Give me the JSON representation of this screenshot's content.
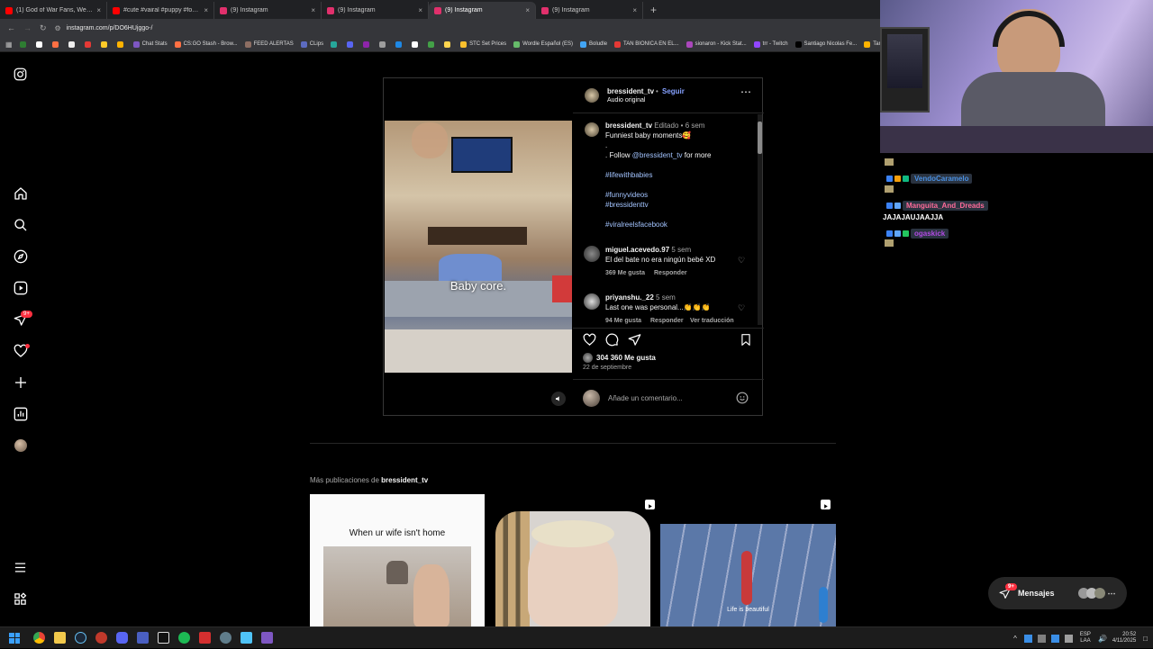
{
  "browser": {
    "tabs": [
      {
        "title": "(1) God of War Fans, We Got S...",
        "icon": "youtube-icon",
        "color": "#ff0000",
        "active": false
      },
      {
        "title": "#cute #vairal #puppy #foryou",
        "icon": "youtube-icon",
        "color": "#ff0000",
        "active": false
      },
      {
        "title": "(9) Instagram",
        "icon": "instagram-icon",
        "color": "#e1306c",
        "active": false
      },
      {
        "title": "(9) Instagram",
        "icon": "instagram-icon",
        "color": "#e1306c",
        "active": false
      },
      {
        "title": "(9) Instagram",
        "icon": "instagram-icon",
        "color": "#e1306c",
        "active": true
      },
      {
        "title": "(9) Instagram",
        "icon": "instagram-icon",
        "color": "#e1306c",
        "active": false
      }
    ],
    "new_tab": "+",
    "url": "instagram.com/p/DO6HUjggo-/",
    "bookmarks": [
      {
        "label": "",
        "color": "#2e7d32"
      },
      {
        "label": "",
        "color": "#ffffff"
      },
      {
        "label": "",
        "color": "#ff7043"
      },
      {
        "label": "",
        "color": "#eeeeee"
      },
      {
        "label": "",
        "color": "#e53935"
      },
      {
        "label": "",
        "color": "#ffca28"
      },
      {
        "label": "",
        "color": "#ffb300"
      },
      {
        "label": "Chat Stats",
        "color": "#7e57c2"
      },
      {
        "label": "CS:GO Stash - Brow...",
        "color": "#ff7043"
      },
      {
        "label": "FEED ALERTAS",
        "color": "#8d6e63"
      },
      {
        "label": "CLips",
        "color": "#5c6bc0"
      },
      {
        "label": "",
        "color": "#26a69a"
      },
      {
        "label": "",
        "color": "#5865f2"
      },
      {
        "label": "",
        "color": "#8e24aa"
      },
      {
        "label": "",
        "color": "#9e9e9e"
      },
      {
        "label": "",
        "color": "#1e88e5"
      },
      {
        "label": "",
        "color": "#ffffff"
      },
      {
        "label": "",
        "color": "#43a047"
      },
      {
        "label": "",
        "color": "#ffd54f"
      },
      {
        "label": "STC Set Prices",
        "color": "#fbc02d"
      },
      {
        "label": "Wordle Español (ES)",
        "color": "#66bb6a"
      },
      {
        "label": "Boludle",
        "color": "#42a5f5"
      },
      {
        "label": "TAN BIONICA EN EL...",
        "color": "#e53935"
      },
      {
        "label": "sionaron - Kick Stat...",
        "color": "#ab47bc"
      },
      {
        "label": "trr - Twitch",
        "color": "#9146ff"
      },
      {
        "label": "Santiago Nicolas Fe...",
        "color": "#000000"
      },
      {
        "label": "Tanuki S",
        "color": "#ffb300"
      }
    ]
  },
  "instagram": {
    "sidebar": [
      {
        "name": "instagram-logo-icon"
      },
      {
        "name": "home-icon"
      },
      {
        "name": "search-icon"
      },
      {
        "name": "explore-icon"
      },
      {
        "name": "reels-icon"
      },
      {
        "name": "messages-icon",
        "badge": "9+"
      },
      {
        "name": "notifications-icon",
        "dot": true
      },
      {
        "name": "create-icon"
      },
      {
        "name": "dashboard-icon"
      },
      {
        "name": "profile-avatar"
      },
      {
        "name": "menu-icon"
      },
      {
        "name": "also-from-meta-icon"
      }
    ],
    "post": {
      "username": "bressident_tv",
      "follow": "Seguir",
      "dot": "•",
      "audio": "Audio original",
      "video_caption": "Baby core.",
      "caption": {
        "user": "bressident_tv",
        "edited": "Editado",
        "time": "6 sem",
        "line1": "Funniest baby moments🥰",
        "line2": ".",
        "line3a": ". Follow ",
        "line3_mention": "@bressident_tv",
        "line3b": " for more",
        "hashtags": [
          "#lifewithbabies",
          "#funnyvideos",
          "#bressidenttv",
          "#viralreelsfacebook"
        ]
      },
      "comments": [
        {
          "user": "miguel.acevedo.97",
          "time": "5 sem",
          "text": "El del bate no era ningún bebé XD",
          "likes": "369 Me gusta",
          "reply": "Responder",
          "translate": ""
        },
        {
          "user": "priyanshu._22",
          "time": "5 sem",
          "text": "Last one was personal...👏👏👏",
          "likes": "94 Me gusta",
          "reply": "Responder",
          "translate": "Ver traducción"
        }
      ],
      "likes": "304 360 Me gusta",
      "date": "22 de septiembre",
      "comment_placeholder": "Añade un comentario..."
    },
    "more_posts_prefix": "Más publicaciones de ",
    "more_posts_user": "bressident_tv",
    "thumbnails": [
      {
        "caption": "When ur wife isn't home",
        "reel": false
      },
      {
        "caption": "",
        "reel": true
      },
      {
        "caption": "Life is beautiful",
        "reel": true
      }
    ],
    "messages_label": "Mensajes",
    "messages_badge": "9+"
  },
  "stream_chat": [
    {
      "user": "VendoCaramelo",
      "color": "#4a90e2",
      "message": ""
    },
    {
      "user": "Manguita_And_Dreads",
      "color": "#ff6b9a",
      "message": "JAJAJAUJAAJJA"
    },
    {
      "user": "ogaskick",
      "color": "#b04ae2",
      "message": ""
    }
  ],
  "taskbar": {
    "lang_top": "ESP",
    "lang_bottom": "LAA",
    "time": "20:52",
    "date": "4/11/2025"
  }
}
